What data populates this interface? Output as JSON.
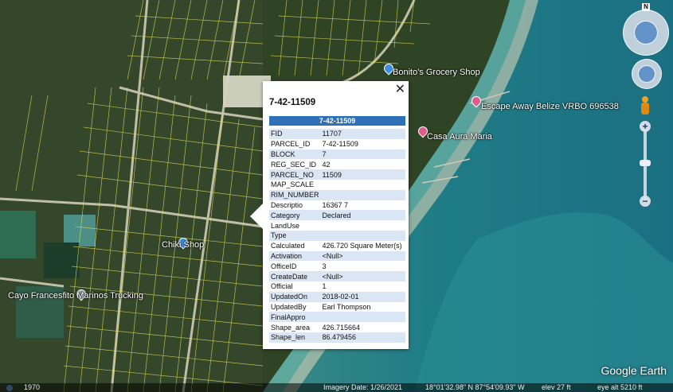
{
  "places": {
    "bonito": "Bonito's Grocery Shop",
    "escape": "Escape Away Belize VRBO 696538",
    "casa": "Casa Aura Maria",
    "chiki": "Chiki Shop",
    "cayo": "Cayo Francesfito Marinos Trucking"
  },
  "popup": {
    "title": "7-42-11509",
    "header": "7-42-11509",
    "close": "✕",
    "rows": [
      {
        "k": "FID",
        "v": "11707"
      },
      {
        "k": "PARCEL_ID",
        "v": "7-42-11509"
      },
      {
        "k": "BLOCK",
        "v": "7"
      },
      {
        "k": "REG_SEC_ID",
        "v": "42"
      },
      {
        "k": "PARCEL_NO",
        "v": "11509"
      },
      {
        "k": "MAP_SCALE",
        "v": ""
      },
      {
        "k": "RIM_NUMBER",
        "v": ""
      },
      {
        "k": "Descriptio",
        "v": "16367 7"
      },
      {
        "k": "Category",
        "v": "Declared"
      },
      {
        "k": "LandUse",
        "v": ""
      },
      {
        "k": "Type",
        "v": ""
      },
      {
        "k": "Calculated",
        "v": "426.720 Square Meter(s)"
      },
      {
        "k": "Activation",
        "v": "<Null>"
      },
      {
        "k": "OfficeID",
        "v": "3"
      },
      {
        "k": "CreateDate",
        "v": "<Null>"
      },
      {
        "k": "Official",
        "v": "1"
      },
      {
        "k": "UpdatedOn",
        "v": "2018-02-01"
      },
      {
        "k": "UpdatedBy",
        "v": "Earl Thompson"
      },
      {
        "k": "FinalAppro",
        "v": ""
      },
      {
        "k": "Shape_area",
        "v": "426.715664"
      },
      {
        "k": "Shape_len",
        "v": "86.479456"
      }
    ]
  },
  "controls": {
    "north": "N",
    "zoom_in": "+",
    "zoom_out": "−"
  },
  "status": {
    "year": "1970",
    "imagery": "Imagery Date: 1/26/2021",
    "coords": "18°01'32.98\" N  87°54'09.93\" W",
    "elev": "elev  27 ft",
    "eye": "eye alt  5210 ft"
  },
  "brand": "Google Earth",
  "colors": {
    "water": "#1d7a80",
    "land": "#2f4424",
    "popup_header": "#2f6fb7",
    "row_alt": "#dbe6f4",
    "parcel": "#e5e25a"
  }
}
